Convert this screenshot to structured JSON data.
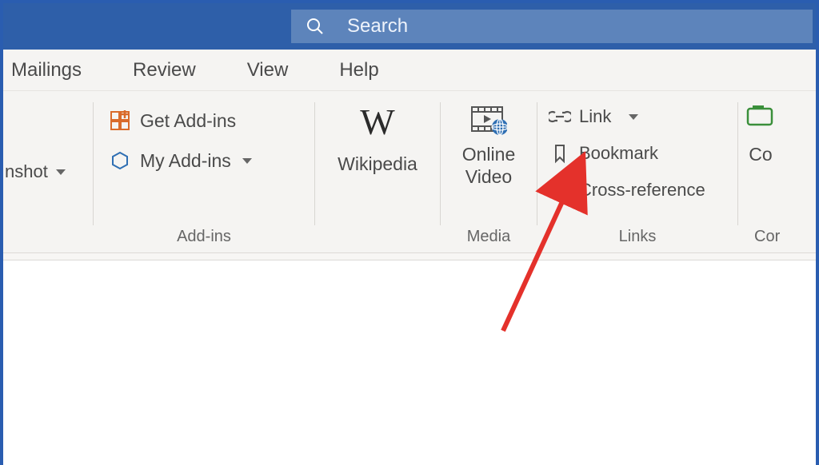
{
  "colors": {
    "title_bar": "#2e5fa9",
    "search_fill": "#5d84bb",
    "ribbon_bg": "#f5f4f2",
    "text": "#4a4a4a",
    "accent_orange": "#d96b2b",
    "accent_blue": "#2f6fb3",
    "annotation_red": "#e4312b"
  },
  "search": {
    "placeholder": "Search"
  },
  "tabs": {
    "mailings": "Mailings",
    "review": "Review",
    "view": "View",
    "help": "Help"
  },
  "ribbon": {
    "screenshot": {
      "label_suffix": "nshot"
    },
    "addins": {
      "get": "Get Add-ins",
      "my": "My Add-ins",
      "group_label": "Add-ins"
    },
    "wikipedia": {
      "label": "Wikipedia"
    },
    "media": {
      "label_line1": "Online",
      "label_line2": "Video",
      "group_label": "Media"
    },
    "links": {
      "link": "Link",
      "bookmark": "Bookmark",
      "cross_ref": "Cross-reference",
      "group_label": "Links"
    },
    "comments": {
      "label_partial": "Co",
      "group_label_partial": "Cor"
    }
  }
}
